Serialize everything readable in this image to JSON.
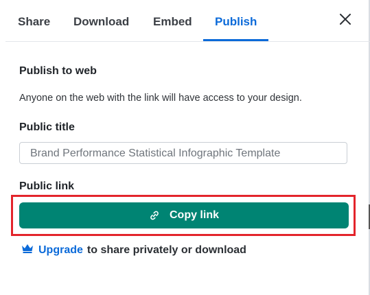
{
  "tabs": [
    {
      "label": "Share"
    },
    {
      "label": "Download"
    },
    {
      "label": "Embed"
    },
    {
      "label": "Publish",
      "active": true
    }
  ],
  "publish": {
    "title": "Publish to web",
    "description": "Anyone on the web with the link will have access to your design.",
    "public_title_label": "Public title",
    "public_title_value": "Brand Performance Statistical Infographic Template",
    "public_link_label": "Public link",
    "copy_link_label": "Copy link",
    "upgrade_link": "Upgrade",
    "upgrade_text": "to share privately or download"
  },
  "icons": {
    "close": "close-icon",
    "link": "link-icon",
    "crown": "crown-icon"
  },
  "colors": {
    "accent": "#0b6ad9",
    "button": "#008473",
    "highlight": "#e3242b"
  }
}
